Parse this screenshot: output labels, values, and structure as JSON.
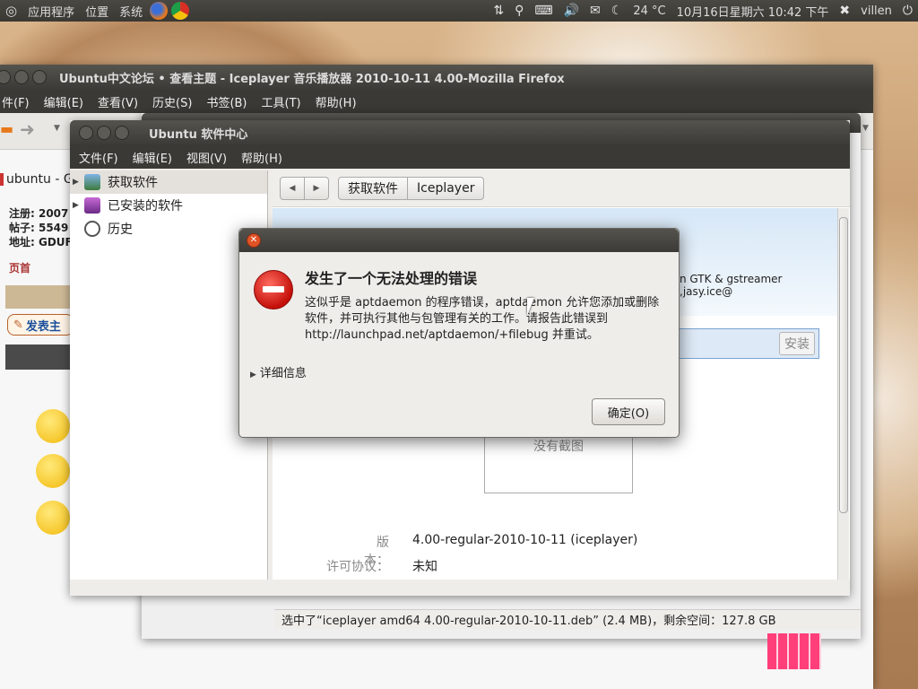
{
  "top_panel": {
    "menus": [
      "应用程序",
      "位置",
      "系统"
    ],
    "temperature": "24 °C",
    "datetime": "10月16日星期六 10:42 下午",
    "username": "villen"
  },
  "firefox": {
    "title": "Ubuntu中文论坛 • 查看主题 - Iceplayer 音乐播放器 2010-10-11 4.00-Mozilla Firefox",
    "menu": [
      "件(F)",
      "编辑(E)",
      "查看(V)",
      "历史(S)",
      "书签(B)",
      "工具(T)",
      "帮助(H)"
    ],
    "tab_label": "ubuntu - G",
    "sidebar": {
      "lines": [
        "注册: 2007",
        "帖子: 5549",
        "地址: GDUF"
      ],
      "homepage": "页首",
      "post_button": "发表主"
    }
  },
  "back_window": {
    "status": "选中了“iceplayer amd64 4.00-regular-2010-10-11.deb” (2.4 MB)，剩余空间：127.8 GB"
  },
  "software_center": {
    "title": "Ubuntu 软件中心",
    "menu": [
      "文件(F)",
      "编辑(E)",
      "视图(V)",
      "帮助(H)"
    ],
    "nav": [
      {
        "label": "获取软件"
      },
      {
        "label": "已安装的软件"
      },
      {
        "label": "历史"
      }
    ],
    "breadcrumb": [
      "获取软件",
      "Iceplayer"
    ],
    "description_fragment": "n GTK & gstreamer ,jasy.ice@",
    "install_button": "安装",
    "no_screenshot": "没有截图",
    "version_label": "版本：",
    "version_value": "4.00-regular-2010-10-11 (iceplayer)",
    "license_label": "许可协议：",
    "license_value": "未知"
  },
  "dialog": {
    "title": "发生了一个无法处理的错误",
    "message": "这似乎是 aptdaemon 的程序错误，aptdaemon 允许您添加或删除软件，并可执行其他与包管理有关的工作。请报告此错误到 http://launchpad.net/aptdaemon/+filebug 并重试。",
    "details_label": "详细信息",
    "ok_button": "确定(O)"
  }
}
